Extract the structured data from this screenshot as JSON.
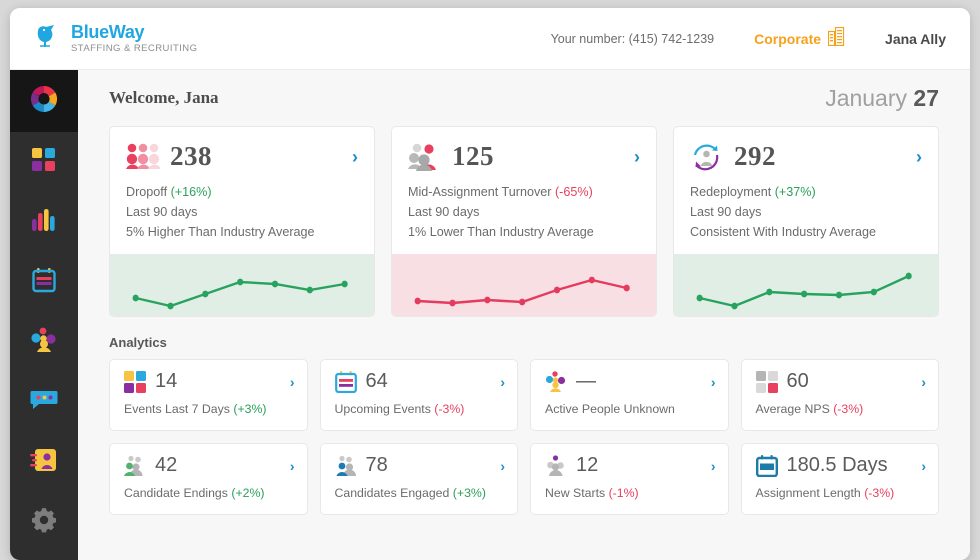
{
  "brand": {
    "name": "BlueWay",
    "tagline": "STAFFING & RECRUITING",
    "logo_icon": "bluebird-logo-icon",
    "color": "#21a7e0"
  },
  "header": {
    "your_number": "Your number: (415) 742-1239",
    "corporate_label": "Corporate",
    "corporate_icon": "office-building-icon",
    "corporate_color": "#f6a11c",
    "user_name": "Jana Ally"
  },
  "sidebar": {
    "logo_icon": "circular-brand-mark-icon",
    "items": [
      {
        "icon": "dashboard-grid-icon",
        "name": "dashboard"
      },
      {
        "icon": "bar-chart-icon",
        "name": "reports"
      },
      {
        "icon": "calendar-icon",
        "name": "calendar"
      },
      {
        "icon": "people-group-icon",
        "name": "people"
      },
      {
        "icon": "chat-bubble-icon",
        "name": "messages"
      },
      {
        "icon": "contact-card-icon",
        "name": "contacts"
      },
      {
        "icon": "gear-icon",
        "name": "settings"
      }
    ]
  },
  "welcome": {
    "greeting": "Welcome, Jana",
    "date_month": "January",
    "date_day": "27"
  },
  "stat_cards": [
    {
      "icon": "three-people-red-icon",
      "value": "238",
      "label": "Dropoff",
      "delta": "(+16%)",
      "delta_tone": "pos",
      "period": "Last 90 days",
      "comparison": "5% Higher Than Industry Average",
      "chevron": "chevron-right-icon",
      "spark_color": "#27a35f",
      "spark_bg": "#e1eee5"
    },
    {
      "icon": "three-people-gray-red-icon",
      "value": "125",
      "label": "Mid-Assignment Turnover",
      "delta": "(-65%)",
      "delta_tone": "neg",
      "period": "Last 90 days",
      "comparison": "1% Lower Than Industry Average",
      "chevron": "chevron-right-icon",
      "spark_color": "#e43b5e",
      "spark_bg": "#f7dfe3"
    },
    {
      "icon": "redeployment-cycle-icon",
      "value": "292",
      "label": "Redeployment",
      "delta": "(+37%)",
      "delta_tone": "pos",
      "period": "Last 90 days",
      "comparison": "Consistent With Industry Average",
      "chevron": "chevron-right-icon",
      "spark_color": "#27a35f",
      "spark_bg": "#e1eee5"
    }
  ],
  "analytics": {
    "title": "Analytics",
    "cards": [
      {
        "icon": "four-square-grid-color-icon",
        "value": "14",
        "label": "Events Last 7 Days",
        "delta": "(+3%)",
        "delta_tone": "pos",
        "chevron": "chevron-right-icon"
      },
      {
        "icon": "calendar-icon",
        "value": "64",
        "label": "Upcoming Events",
        "delta": "(-3%)",
        "delta_tone": "neg",
        "chevron": "chevron-right-icon"
      },
      {
        "icon": "people-group-color-icon",
        "value": "—",
        "label": "Active People Unknown",
        "delta": "",
        "delta_tone": "pos",
        "chevron": "chevron-right-icon"
      },
      {
        "icon": "four-square-grid-gray-icon",
        "value": "60",
        "label": "Average NPS",
        "delta": "(-3%)",
        "delta_tone": "neg",
        "chevron": "chevron-right-icon"
      },
      {
        "icon": "people-green-gray-icon",
        "value": "42",
        "label": "Candidate Endings",
        "delta": "(+2%)",
        "delta_tone": "pos",
        "chevron": "chevron-right-icon"
      },
      {
        "icon": "people-blue-gray-icon",
        "value": "78",
        "label": "Candidates Engaged",
        "delta": "(+3%)",
        "delta_tone": "pos",
        "chevron": "chevron-right-icon"
      },
      {
        "icon": "people-purple-gray-icon",
        "value": "12",
        "label": "New Starts",
        "delta": "(-1%)",
        "delta_tone": "neg",
        "chevron": "chevron-right-icon"
      },
      {
        "icon": "calendar-blue-icon",
        "value": "180.5 Days",
        "label": "Assignment Length",
        "delta": "(-3%)",
        "delta_tone": "neg",
        "chevron": "chevron-right-icon"
      }
    ]
  },
  "chart_data": [
    {
      "type": "line",
      "title": "Dropoff — Last 90 days",
      "x": [
        0,
        1,
        2,
        3,
        4,
        5,
        6
      ],
      "values": [
        34,
        20,
        40,
        63,
        59,
        48,
        58
      ],
      "ylim": [
        0,
        100
      ],
      "grid": false,
      "legend": "none",
      "color": "#27a35f"
    },
    {
      "type": "line",
      "title": "Mid-Assignment Turnover — Last 90 days",
      "x": [
        0,
        1,
        2,
        3,
        4,
        5,
        6
      ],
      "values": [
        22,
        18,
        23,
        20,
        48,
        68,
        52
      ],
      "ylim": [
        0,
        100
      ],
      "grid": false,
      "legend": "none",
      "color": "#e43b5e"
    },
    {
      "type": "line",
      "title": "Redeployment — Last 90 days",
      "x": [
        0,
        1,
        2,
        3,
        4,
        5,
        6
      ],
      "values": [
        34,
        20,
        44,
        41,
        39,
        44,
        74
      ],
      "ylim": [
        0,
        100
      ],
      "grid": false,
      "legend": "none",
      "color": "#27a35f"
    }
  ]
}
